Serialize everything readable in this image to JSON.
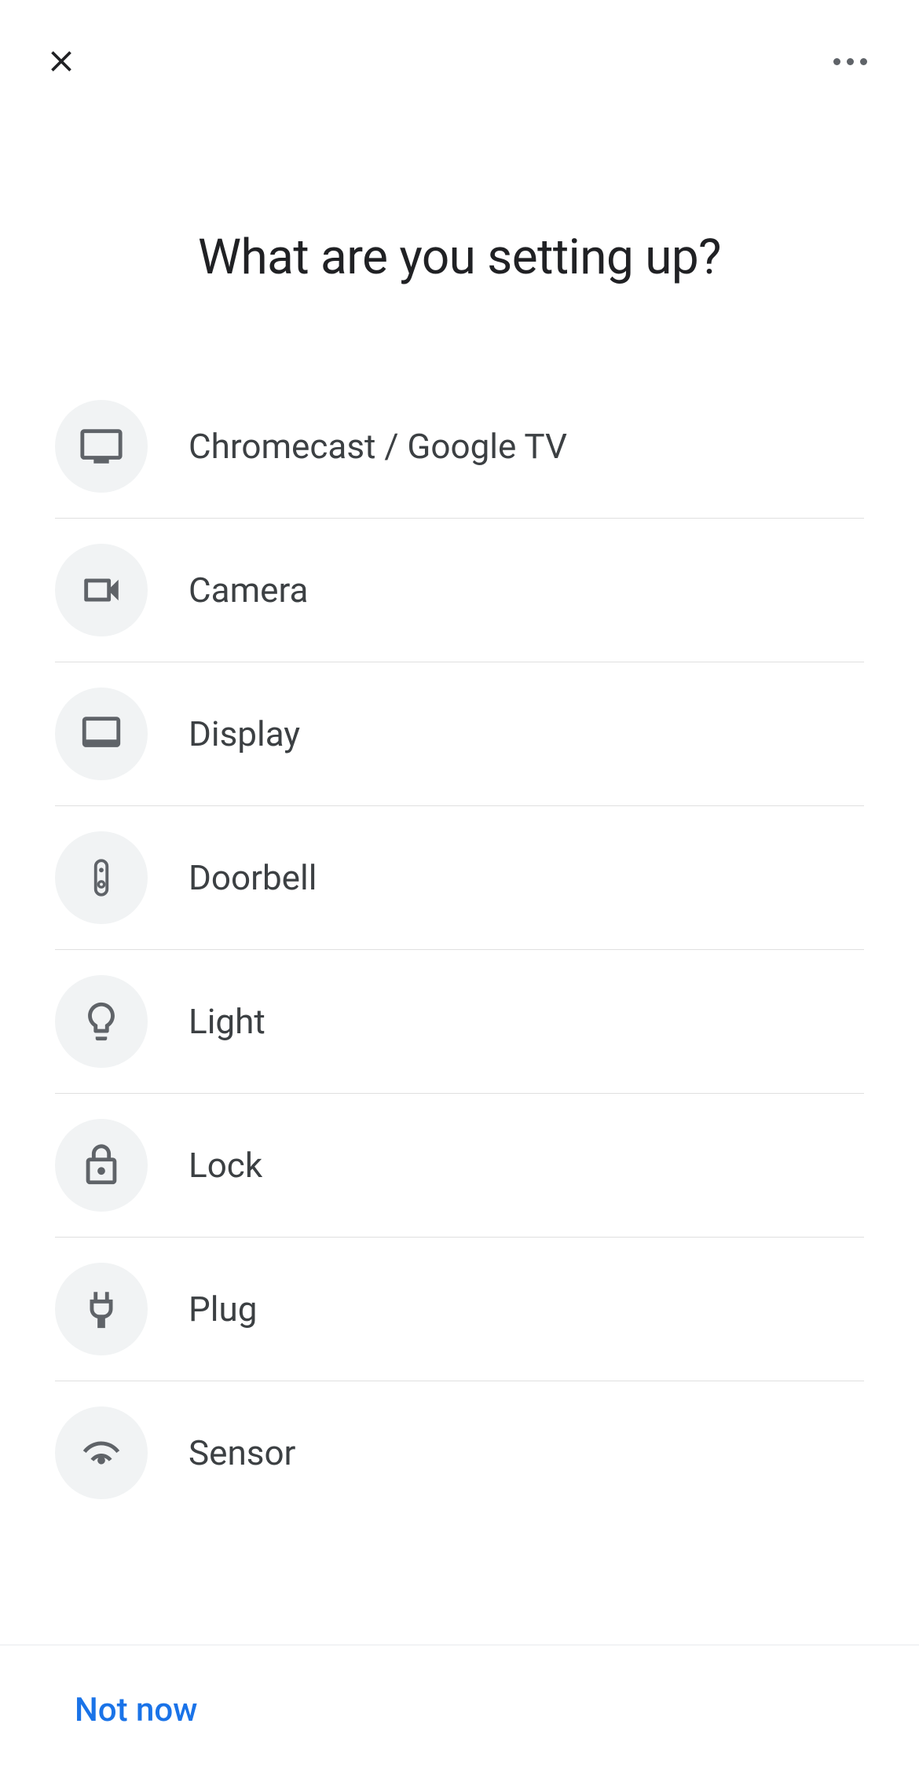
{
  "header": {
    "title": "What are you setting up?"
  },
  "devices": [
    {
      "id": "chromecast",
      "label": "Chromecast / Google TV",
      "icon": "tv"
    },
    {
      "id": "camera",
      "label": "Camera",
      "icon": "camera"
    },
    {
      "id": "display",
      "label": "Display",
      "icon": "display"
    },
    {
      "id": "doorbell",
      "label": "Doorbell",
      "icon": "doorbell"
    },
    {
      "id": "light",
      "label": "Light",
      "icon": "light"
    },
    {
      "id": "lock",
      "label": "Lock",
      "icon": "lock"
    },
    {
      "id": "plug",
      "label": "Plug",
      "icon": "plug"
    },
    {
      "id": "sensor",
      "label": "Sensor",
      "icon": "sensor"
    }
  ],
  "footer": {
    "not_now": "Not now"
  }
}
